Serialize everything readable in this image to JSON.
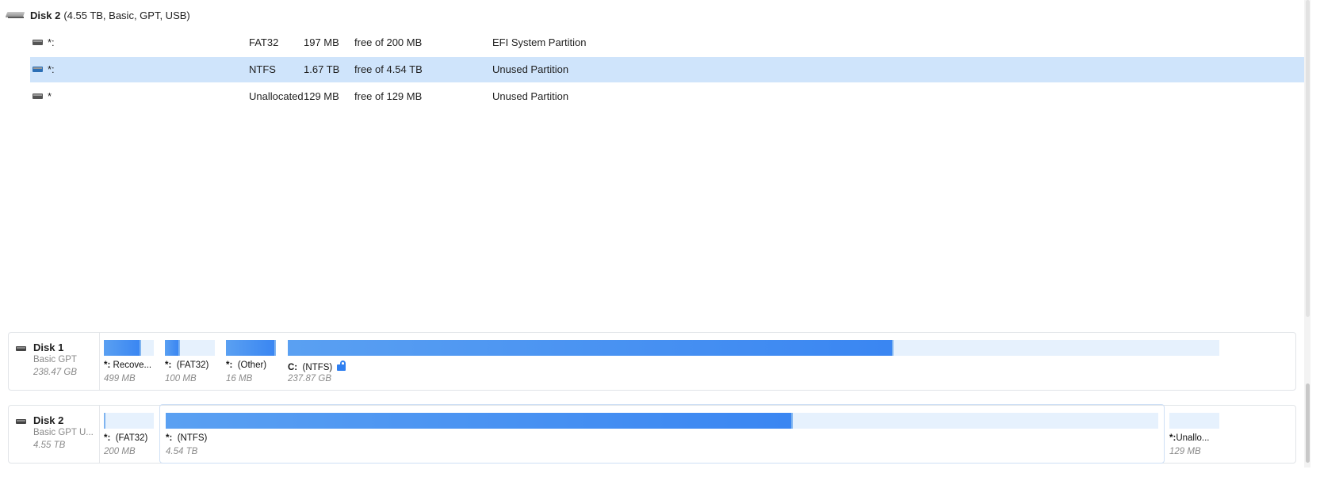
{
  "disk_list": {
    "header": {
      "title": "Disk 2",
      "meta": "(4.55 TB, Basic, GPT, USB)"
    },
    "rows": [
      {
        "name": "*:",
        "fs": "FAT32",
        "size": "197 MB",
        "free": "free of 200 MB",
        "type": "EFI System Partition",
        "selected": false
      },
      {
        "name": "*:",
        "fs": "NTFS",
        "size": "1.67 TB",
        "free": "free of 4.54 TB",
        "type": "Unused Partition",
        "selected": true
      },
      {
        "name": "*",
        "fs": "Unallocated",
        "size": "129 MB",
        "free": "free of 129 MB",
        "type": "Unused Partition",
        "selected": false
      }
    ]
  },
  "disk_map": {
    "disk1": {
      "name": "Disk 1",
      "type": "Basic GPT",
      "size": "238.47 GB",
      "partitions": [
        {
          "label_prefix": "*:",
          "label": "Recove...",
          "size": "499 MB",
          "used_fraction": 0.75
        },
        {
          "label_prefix": "*:",
          "label": "(FAT32)",
          "size": "100 MB",
          "used_fraction": 0.3
        },
        {
          "label_prefix": "*:",
          "label": "(Other)",
          "size": "16 MB",
          "used_fraction": 1.0
        },
        {
          "label_prefix": "C:",
          "label": "(NTFS)",
          "size": "237.87 GB",
          "used_fraction": 0.65,
          "icon": "unlock-icon"
        }
      ]
    },
    "disk2": {
      "name": "Disk 2",
      "type": "Basic GPT U...",
      "size": "4.55 TB",
      "partitions": [
        {
          "label_prefix": "*:",
          "label": "(FAT32)",
          "size": "200 MB",
          "used_fraction": 0.02
        },
        {
          "label_prefix": "*:",
          "label": "(NTFS)",
          "size": "4.54 TB",
          "used_fraction": 0.632
        },
        {
          "label_prefix": "*:",
          "label": "Unallo...",
          "size": "129 MB",
          "used_fraction": 0
        }
      ]
    }
  },
  "colors": {
    "accent": "#3a86f2",
    "selection": "#cfe4fb",
    "bar_empty": "#e6f1fd"
  }
}
